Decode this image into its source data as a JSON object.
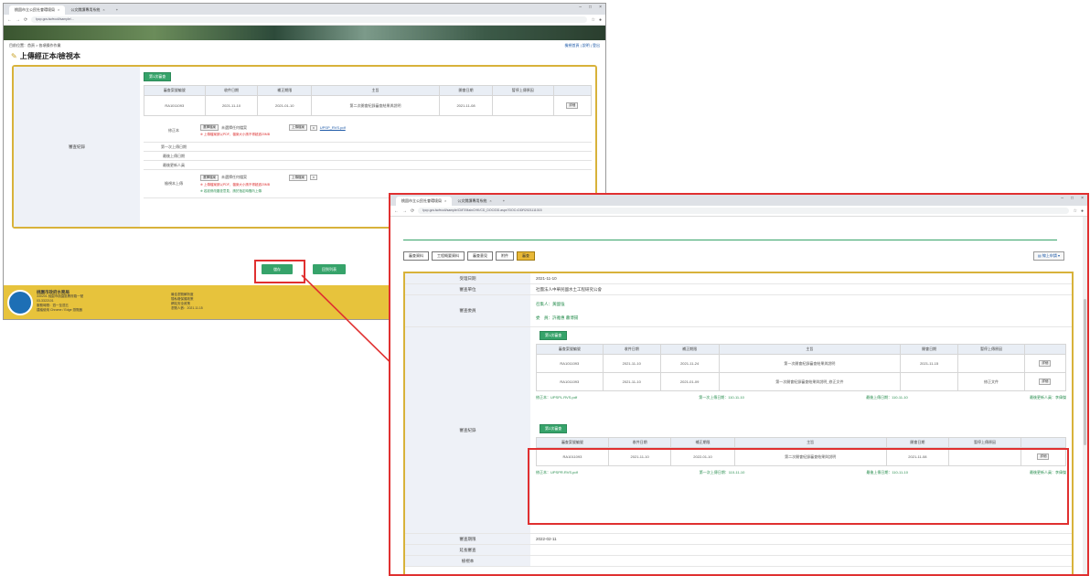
{
  "window1": {
    "tabs": [
      "桃園市立公民社會環境局",
      "公文閱讀專用系統"
    ],
    "url": "tycp.gov.tw/ecoli/sample/...",
    "breadcrumb": "目前位置：首頁 > 各項操作作業",
    "top_right_links": "檢視首頁 | 說明 | 登出",
    "page_title": "上傳經正本/檢視本",
    "badge": "第1次審查",
    "table_headers": [
      "審查案號編號",
      "收件日期",
      "補正期限",
      "主旨",
      "開會日期",
      "暫停上傳原因",
      ""
    ],
    "table_row": [
      "RA1011093",
      "2021-11-10",
      "2021-01-10",
      "第二次開會紀錄審查結果與說明",
      "2021-11-08",
      "",
      "詳細"
    ],
    "side_label": "審查紀錄",
    "labels": [
      "修正本",
      "第一次上傳日期",
      "最後上傳日期",
      "最後更新人員",
      "檢視本上傳"
    ],
    "file_btn": "選擇檔案",
    "no_file": "未選擇任何檔案",
    "upload_btn": "上傳檔案",
    "file_link": "UPSP_RVS.pdf",
    "warn1": "※ 上傳檔案請以PDF，檔案大小請不得超過20MB",
    "warn2": "※ 上傳檔案請以PDF，檔案大小請不得超過20MB",
    "warn3": "※ 若欲修改審查意見，請於指定時間內上傳",
    "save_btn": "儲存",
    "back_btn": "回到列表",
    "footer_lines": [
      "桃園市政府水務局",
      "330201 桃園市桃園區縣府路一號",
      "03-3322101",
      "服務時間：週一至週五",
      "建議使用 Chrome / Edge 瀏覽器"
    ],
    "footer_col2": [
      "最佳瀏覽解析度",
      "隱私權保護政策",
      "網站安全政策",
      "瀏覽人數：2021.11.15"
    ]
  },
  "window2": {
    "tabs": [
      "桃園市立公民社會環境局",
      "公文閱讀專用系統"
    ],
    "url": "tycp.gov.tw/ecoli/sample/CMT/MainCHK/CD_DOC/DD.aspx?DOC=DDR2021111015",
    "tool_buttons": [
      "審查資料",
      "工程概要資料",
      "審查意見",
      "附件",
      "審查"
    ],
    "upload_main": "線上申請",
    "fields": [
      {
        "k": "受理日期",
        "v": "2021-11-10"
      },
      {
        "k": "審查單位",
        "v": "社團法人中華民國水土工程研究公會"
      }
    ],
    "members_label": "審查委員",
    "members": [
      "召集人：黃國強",
      "委　員：許雅惠 蕭博揚"
    ],
    "record_label": "審查紀錄",
    "badge1": "第1次審查",
    "badge2": "第2次審查",
    "table_headers": [
      "審查案號編號",
      "收件日期",
      "補正期限",
      "主旨",
      "開會日期",
      "暫停上傳原因",
      ""
    ],
    "table1_rows": [
      [
        "RA1011093",
        "2021-11-10",
        "2021-11-24",
        "第一次開會紀錄審查結果與說明",
        "2021-11-15",
        "",
        "詳細"
      ],
      [
        "RA1011093",
        "2021-11-10",
        "2021-01-09",
        "第一次開會紀錄審查結果與說明_修正文件",
        "",
        "修正文件",
        "詳細"
      ]
    ],
    "table2_rows": [
      [
        "RA1011093",
        "2021-11-10",
        "2022-01-10",
        "第二次開會紀錄審查結果與說明",
        "2021-11-08",
        "",
        "詳細"
      ]
    ],
    "summary1": {
      "file": "修正本：UPSPL.RVS.pdf",
      "first": "第一次上傳日期：110-11-10",
      "last": "最後上傳日期：110-11-10",
      "who": "最後更新人員：李偉傑"
    },
    "summary2": {
      "file": "修正本：UPSPR.RVS.pdf",
      "first": "第一次上傳日期：110-11-10",
      "last": "最後上傳日期：110-11-10",
      "who": "最後更新人員：李偉傑"
    },
    "bottom_fields": [
      {
        "k": "審查期限",
        "v": "2022-02-11"
      },
      {
        "k": "延長審查",
        "v": ""
      },
      {
        "k": "檢視本",
        "v": ""
      }
    ]
  },
  "colors": {
    "accent_green": "#36a36a",
    "panel_gold": "#d8b23a",
    "highlight_red": "#e03030"
  }
}
